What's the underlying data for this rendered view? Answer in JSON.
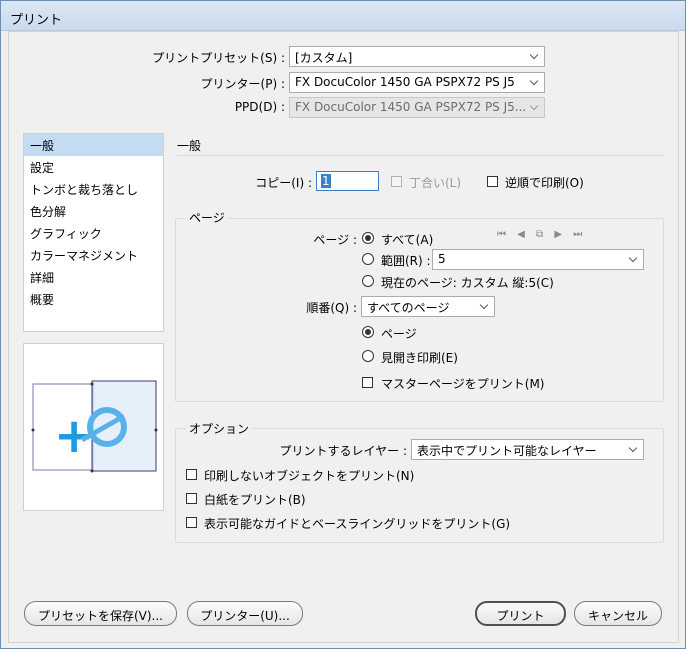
{
  "window": {
    "title": "プリント"
  },
  "top": {
    "preset_label": "プリントプリセット(S) :",
    "preset_value": "[カスタム]",
    "printer_label": "プリンター(P) :",
    "printer_value": "FX DocuColor 1450 GA PSPX72 PS J5",
    "ppd_label": "PPD(D) :",
    "ppd_value": "FX DocuColor 1450 GA PSPX72 PS J5..."
  },
  "sidebar": {
    "items": [
      {
        "label": "一般",
        "selected": true
      },
      {
        "label": "設定"
      },
      {
        "label": "トンボと裁ち落とし"
      },
      {
        "label": "色分解"
      },
      {
        "label": "グラフィック"
      },
      {
        "label": "カラーマネジメント"
      },
      {
        "label": "詳細"
      },
      {
        "label": "概要"
      }
    ]
  },
  "main": {
    "section_title": "一般",
    "copies_label": "コピー(I) :",
    "copies_value": "1",
    "collate_label": "丁合い(L)",
    "reverse_label": "逆順で印刷(O)",
    "pages_group": {
      "title": "ページ",
      "pages_label": "ページ :",
      "all_label": "すべて(A)",
      "range_label": "範囲(R) :",
      "range_value": "5",
      "current_label": "現在のページ: カスタム 縦:5(C)",
      "sequence_label": "順番(Q) :",
      "sequence_value": "すべてのページ",
      "pages_option": "ページ",
      "spreads_option": "見開き印刷(E)",
      "master_label": "マスターページをプリント(M)"
    },
    "options_group": {
      "title": "オプション",
      "layers_label": "プリントするレイヤー :",
      "layers_value": "表示中でプリント可能なレイヤー",
      "nonprinting_label": "印刷しないオブジェクトをプリント(N)",
      "blank_label": "白紙をプリント(B)",
      "guides_label": "表示可能なガイドとベースライングリッドをプリント(G)"
    }
  },
  "footer": {
    "save_preset": "プリセットを保存(V)...",
    "printer_button": "プリンター(U)...",
    "print_button": "プリント",
    "cancel_button": "キャンセル"
  },
  "colors": {
    "accent": "#c3dcf4",
    "preview_blue": "#1e9be0"
  }
}
